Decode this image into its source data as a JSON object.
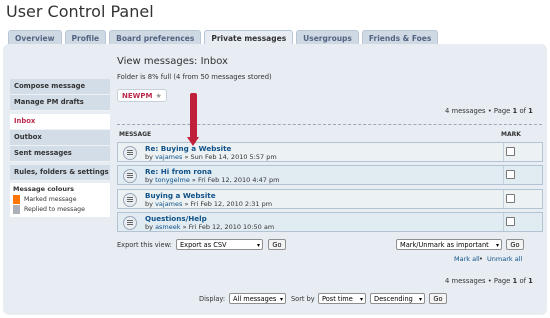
{
  "title": "User Control Panel",
  "tabs": [
    "Overview",
    "Profile",
    "Board preferences",
    "Private messages",
    "Usergroups",
    "Friends & Foes"
  ],
  "sidebar": {
    "group1": [
      "Compose message",
      "Manage PM drafts"
    ],
    "group2": [
      "Inbox",
      "Outbox",
      "Sent messages"
    ],
    "group3": [
      "Rules, folders & settings"
    ]
  },
  "message_colours": {
    "title": "Message colours",
    "items": [
      {
        "label": "Marked message",
        "color": "#ff7700"
      },
      {
        "label": "Replied to message",
        "color": "#aab1b8"
      }
    ]
  },
  "main": {
    "heading": "View messages: Inbox",
    "folder_info": "Folder is 8% full (4 from 50 messages stored)",
    "newpm": "NEWPM",
    "pagination_prefix": "4 messages • Page",
    "page_current": "1",
    "page_of": "of",
    "page_total": "1",
    "col_message": "MESSAGE",
    "col_mark": "MARK",
    "messages": [
      {
        "subject": "Re: Buying a Website",
        "by": "by",
        "author": "vajames",
        "date": "» Sun Feb 14, 2010 5:57 pm"
      },
      {
        "subject": "Re: Hi from rona",
        "by": "by",
        "author": "tonygelme",
        "date": "» Fri Feb 12, 2010 4:47 pm"
      },
      {
        "subject": "Buying a Website",
        "by": "by",
        "author": "vajames",
        "date": "» Fri Feb 12, 2010 2:31 pm"
      },
      {
        "subject": "Questions/Help",
        "by": "by",
        "author": "asmeek",
        "date": "» Fri Feb 12, 2010 10:50 am"
      }
    ],
    "export_label": "Export this view:",
    "export_value": "Export as CSV",
    "go": "Go",
    "mark_select": "Mark/Unmark as important",
    "mark_all": "Mark all",
    "unmark_all": "Unmark all",
    "display_label": "Display:",
    "display_value": "All messages",
    "sort_label": "Sort by",
    "sort_value": "Post time",
    "order_value": "Descending"
  }
}
